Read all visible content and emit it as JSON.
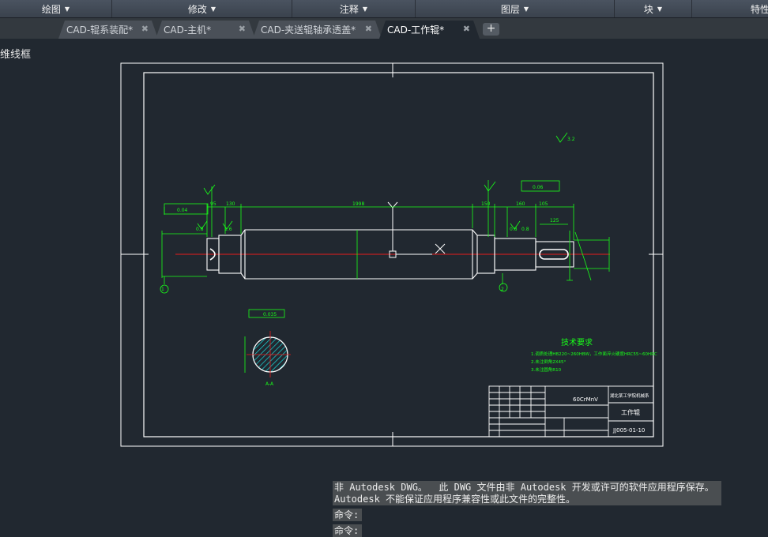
{
  "ribbon": {
    "panels": [
      "绘图",
      "修改",
      "注释",
      "图层",
      "块",
      "特性"
    ]
  },
  "tabs": [
    {
      "label": "CAD-辊系装配*",
      "active": false
    },
    {
      "label": "CAD-主机*",
      "active": false
    },
    {
      "label": "CAD-夹送辊轴承透盖*",
      "active": false
    },
    {
      "label": "CAD-工作辊*",
      "active": true
    }
  ],
  "new_tab_label": "+",
  "tab_close_glyph": "✖",
  "view_label": "维线框",
  "drawing": {
    "dims": {
      "overall_length": "1998",
      "left_body": "130",
      "right_body": "150",
      "right_mid": "160",
      "key_len": "125",
      "small_a": "95",
      "small_b": "105"
    },
    "tolerance_left": "0.04",
    "tolerance_right": "0.06",
    "tolerance_section": "0.035",
    "roughness_marks": [
      "1.6",
      "0.8",
      "3.2"
    ],
    "datum_left": "1",
    "datum_right": "2",
    "section_label": "A-A",
    "tech_req": {
      "title": "技术要求",
      "lines": [
        "1.调质处理HB220~260HBW，工作面淬火硬度HRC55~60HRC",
        "2.未注倒角2X45°",
        "3.未注圆角R10"
      ]
    },
    "title_block": {
      "material": "60CrMnV",
      "company": "湖北某工学院机械系",
      "part_name": "工作辊",
      "drawing_no": "JJ005-01-10"
    }
  },
  "command": {
    "history": [
      "非 Autodesk DWG。  此 DWG 文件由非 Autodesk 开发或许可的软件应用程序保存。",
      "Autodesk 不能保证应用程序兼容性或此文件的完整性。"
    ],
    "prompt1": "命令:",
    "prompt2": "命令:"
  },
  "colors": {
    "background": "#212830",
    "dimension": "#19ff19",
    "centerline": "#e81b1b",
    "hatch": "#19e8e8",
    "geometry": "#ffffff"
  }
}
